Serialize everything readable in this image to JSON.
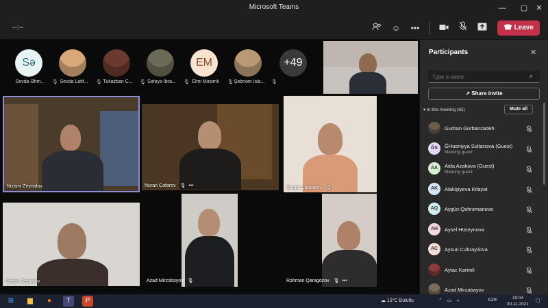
{
  "titlebar": {
    "title": "Microsoft Teams"
  },
  "toolbar": {
    "timer": "--:--",
    "leave_label": "Leave"
  },
  "avatars": [
    {
      "initials": "Sə",
      "name": "Sevda Əhm...",
      "bg": "#e8f4f4",
      "fg": "#2a6d7a"
    },
    {
      "initials": "",
      "name": "Sevda Latif...",
      "bg": "#d9a87a",
      "fg": "#fff"
    },
    {
      "initials": "",
      "name": "Tukazban C...",
      "bg": "#6a3a2e",
      "fg": "#fff"
    },
    {
      "initials": "",
      "name": "Səfəyə İbra...",
      "bg": "#6e6a58",
      "fg": "#fff"
    },
    {
      "initials": "EM",
      "name": "Elmi Məsimli",
      "bg": "#f7e3d0",
      "fg": "#8a4a2a"
    },
    {
      "initials": "",
      "name": "Şəbnəm İsla...",
      "bg": "#b89a74",
      "fg": "#fff"
    },
    {
      "initials": "+49",
      "name": "",
      "bg": "#3a3a3a",
      "fg": "#fff"
    }
  ],
  "tiles": {
    "nizami": "Nizami Zeynalov",
    "nuran": "Nuran Cəfərov",
    "cingiz": "Çingiz Cabbarov",
    "ozeyir": "Üzeyir Zeynalov",
    "azad": "Azad Mirzəbəyov",
    "rahman": "Rəhman Qaragözov"
  },
  "panel": {
    "title": "Participants",
    "search_placeholder": "Type a name",
    "share_label": "Share invite",
    "section_label": "In this meeting (62)",
    "mute_all_label": "Mute all",
    "participants": [
      {
        "initials": "",
        "name": "Gurban Gurbanzadeh",
        "sub": "",
        "bg": "#6b5b4b"
      },
      {
        "initials": "ĞS",
        "name": "ĞHusniyya Sultanova (Guest)",
        "sub": "Meeting guest",
        "bg": "#e4d9f2"
      },
      {
        "initials": "AA",
        "name": "Aida Azakova (Guest)",
        "sub": "Meeting guest",
        "bg": "#d5efd0"
      },
      {
        "initials": "AK",
        "name": "Alakişiyeva Kifayət",
        "sub": "",
        "bg": "#d6e4f7"
      },
      {
        "initials": "AQ",
        "name": "Aygün Qəhrəmanova",
        "sub": "",
        "bg": "#d2eef0"
      },
      {
        "initials": "AH",
        "name": "Aysel Hüseynova",
        "sub": "",
        "bg": "#f6d8e3"
      },
      {
        "initials": "AC",
        "name": "Aysun Cəbrayılova",
        "sub": "",
        "bg": "#f6ddd6"
      },
      {
        "initials": "",
        "name": "Aytac Kərimli",
        "sub": "",
        "bg": "#8a3b3b"
      },
      {
        "initials": "",
        "name": "Azad Mirzabayov",
        "sub": "",
        "bg": "#7b6b5a"
      }
    ]
  },
  "taskbar": {
    "weather": "13°C Bulutlu",
    "lang": "AZE",
    "time": "19:04",
    "date": "30.11.2021"
  },
  "colors": {
    "accent": "#6264a7",
    "leave": "#c4314b",
    "panel_bg": "#292929"
  }
}
